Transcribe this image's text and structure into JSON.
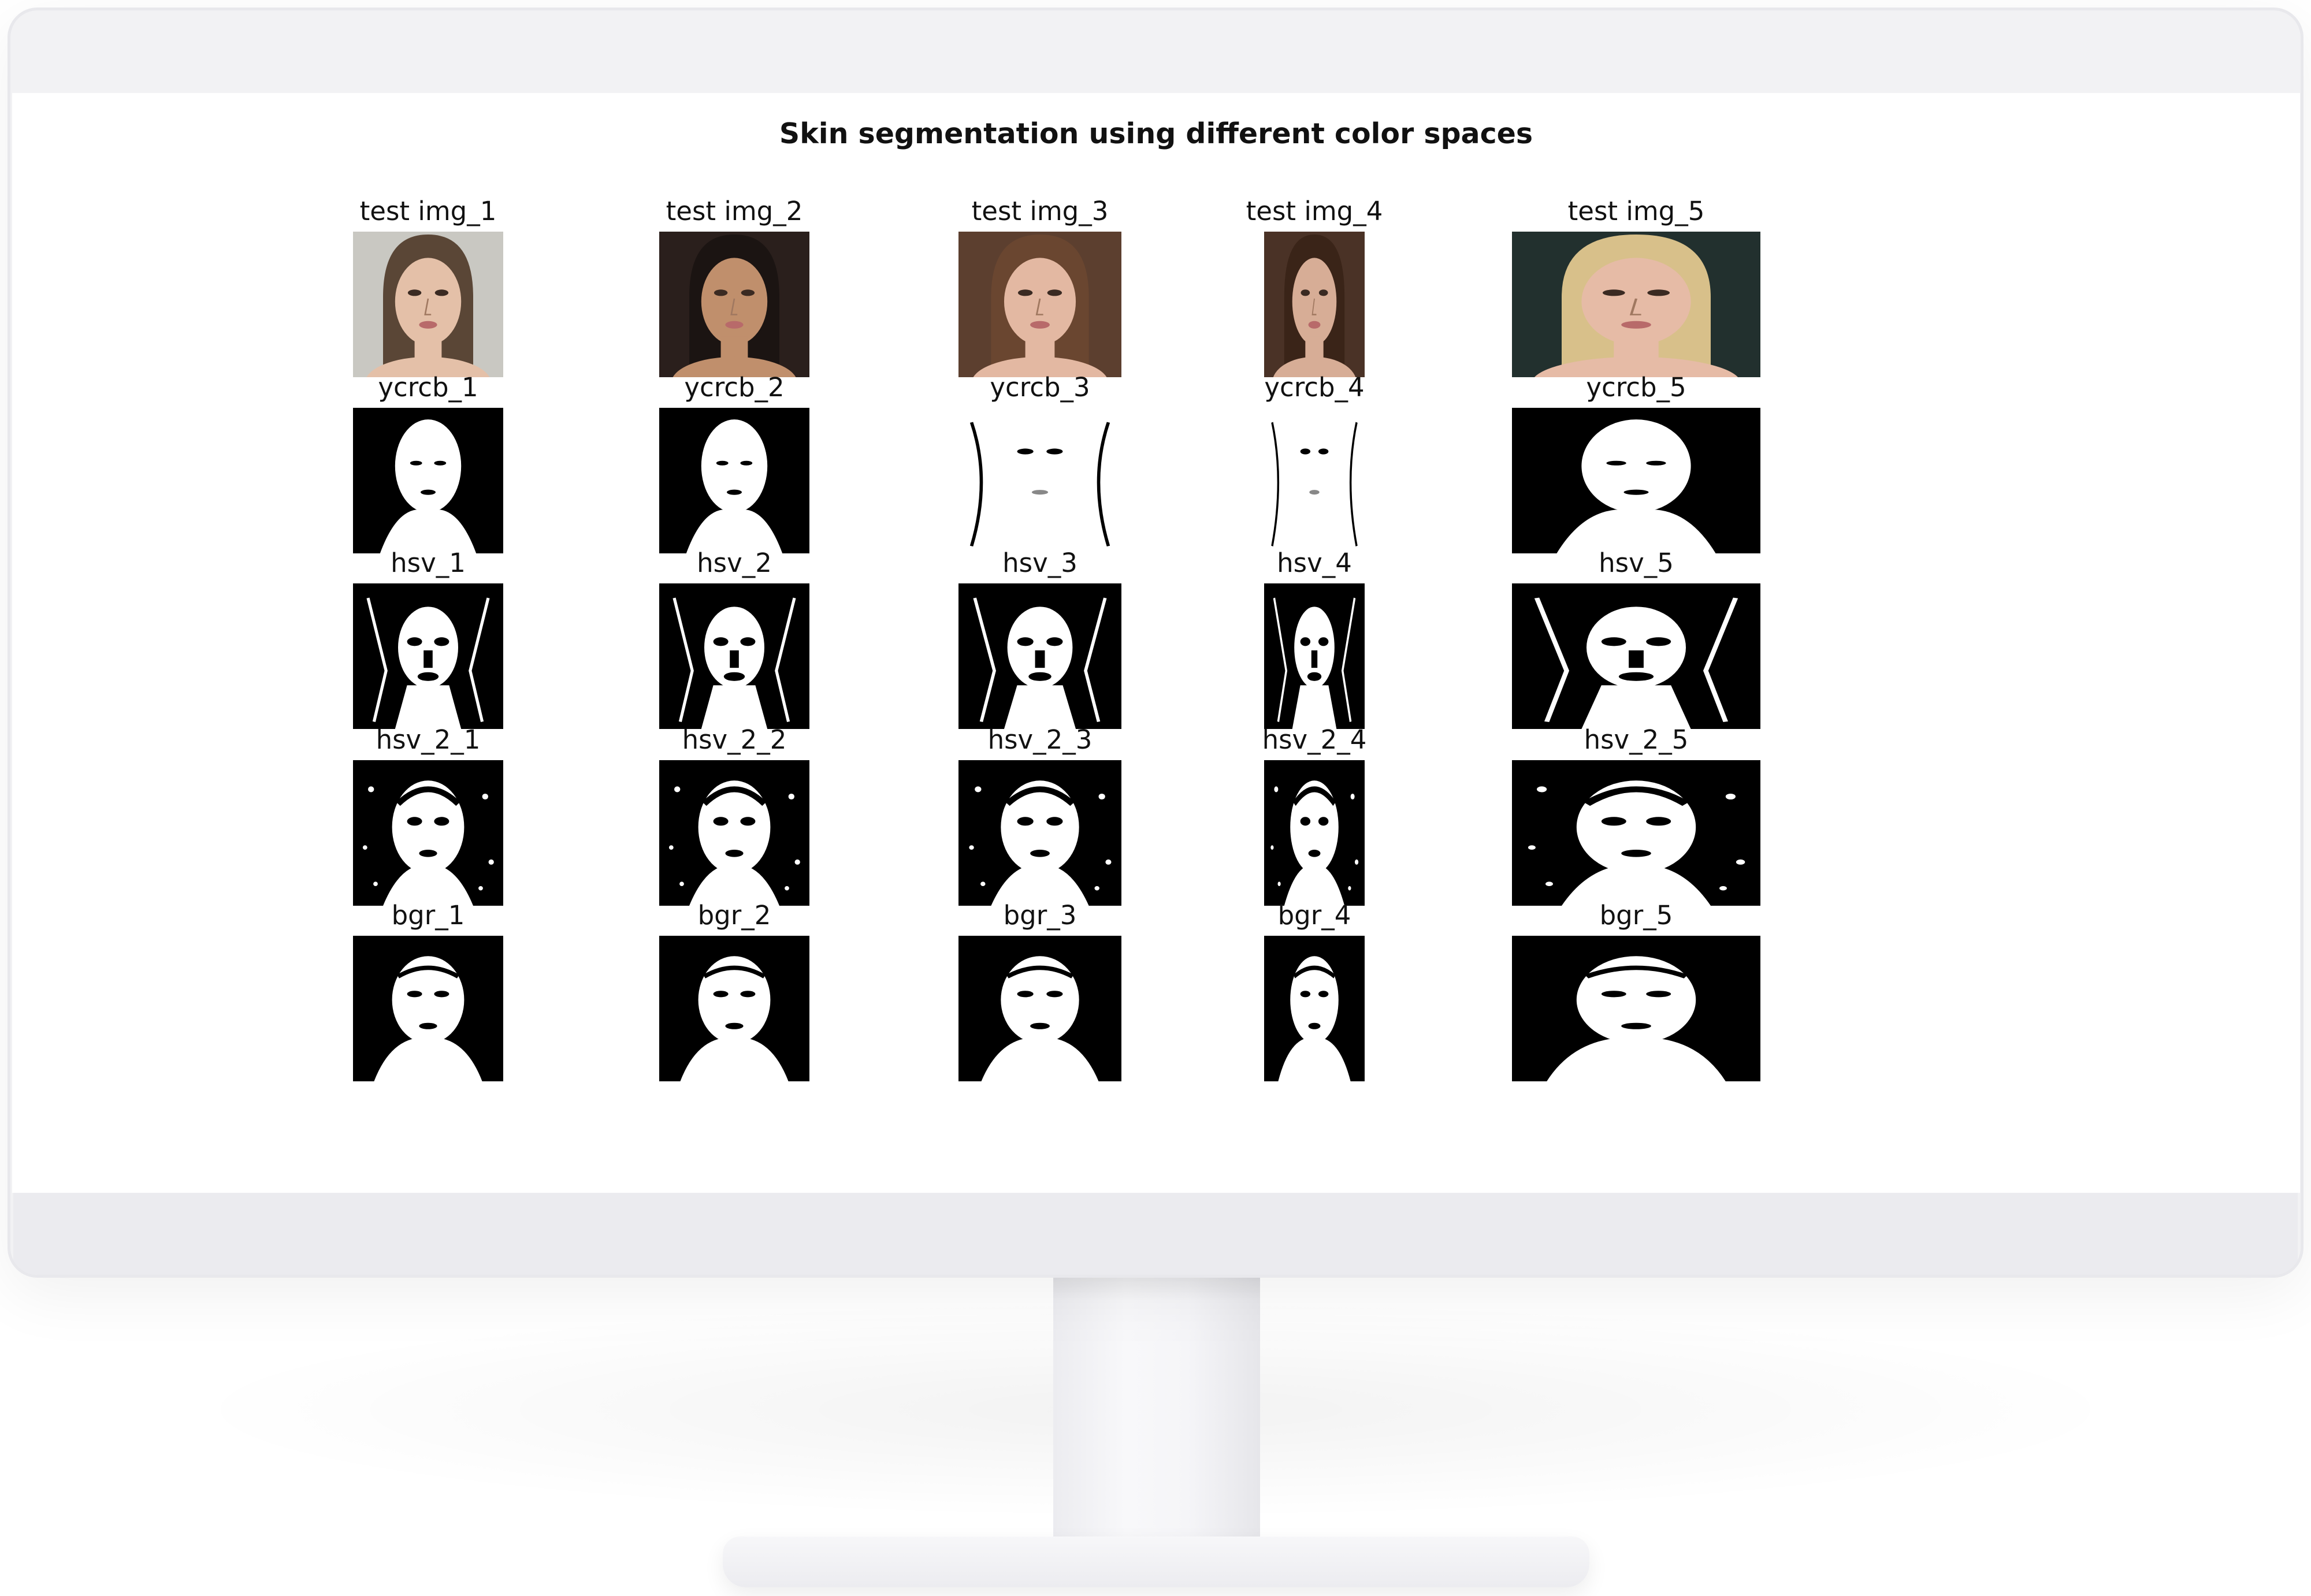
{
  "figure": {
    "title": "Skin segmentation using different color spaces",
    "columns": [
      {
        "bg": "#c9c8c2",
        "skin": "#e4c0a8",
        "hair": "#5a4636"
      },
      {
        "bg": "#2a1f1c",
        "skin": "#c08f6c",
        "hair": "#1b1412"
      },
      {
        "bg": "#5c3f2f",
        "skin": "#e3b8a2",
        "hair": "#6a4630"
      },
      {
        "bg": "#4a3226",
        "skin": "#d7ad96",
        "hair": "#3a2418"
      },
      {
        "bg": "#22302e",
        "skin": "#e6bba6",
        "hair": "#d8c08a"
      }
    ],
    "rows": [
      {
        "kind": "photo",
        "labels": [
          "test img_1",
          "test img_2",
          "test img_3",
          "test img_4",
          "test img_5"
        ]
      },
      {
        "kind": "mask",
        "labels": [
          "ycrcb_1",
          "ycrcb_2",
          "ycrcb_3",
          "ycrcb_4",
          "ycrcb_5"
        ]
      },
      {
        "kind": "mask",
        "labels": [
          "hsv_1",
          "hsv_2",
          "hsv_3",
          "hsv_4",
          "hsv_5"
        ]
      },
      {
        "kind": "mask",
        "labels": [
          "hsv_2_1",
          "hsv_2_2",
          "hsv_2_3",
          "hsv_2_4",
          "hsv_2_5"
        ]
      },
      {
        "kind": "mask",
        "labels": [
          "bgr_1",
          "bgr_2",
          "bgr_3",
          "bgr_4",
          "bgr_5"
        ]
      }
    ]
  }
}
